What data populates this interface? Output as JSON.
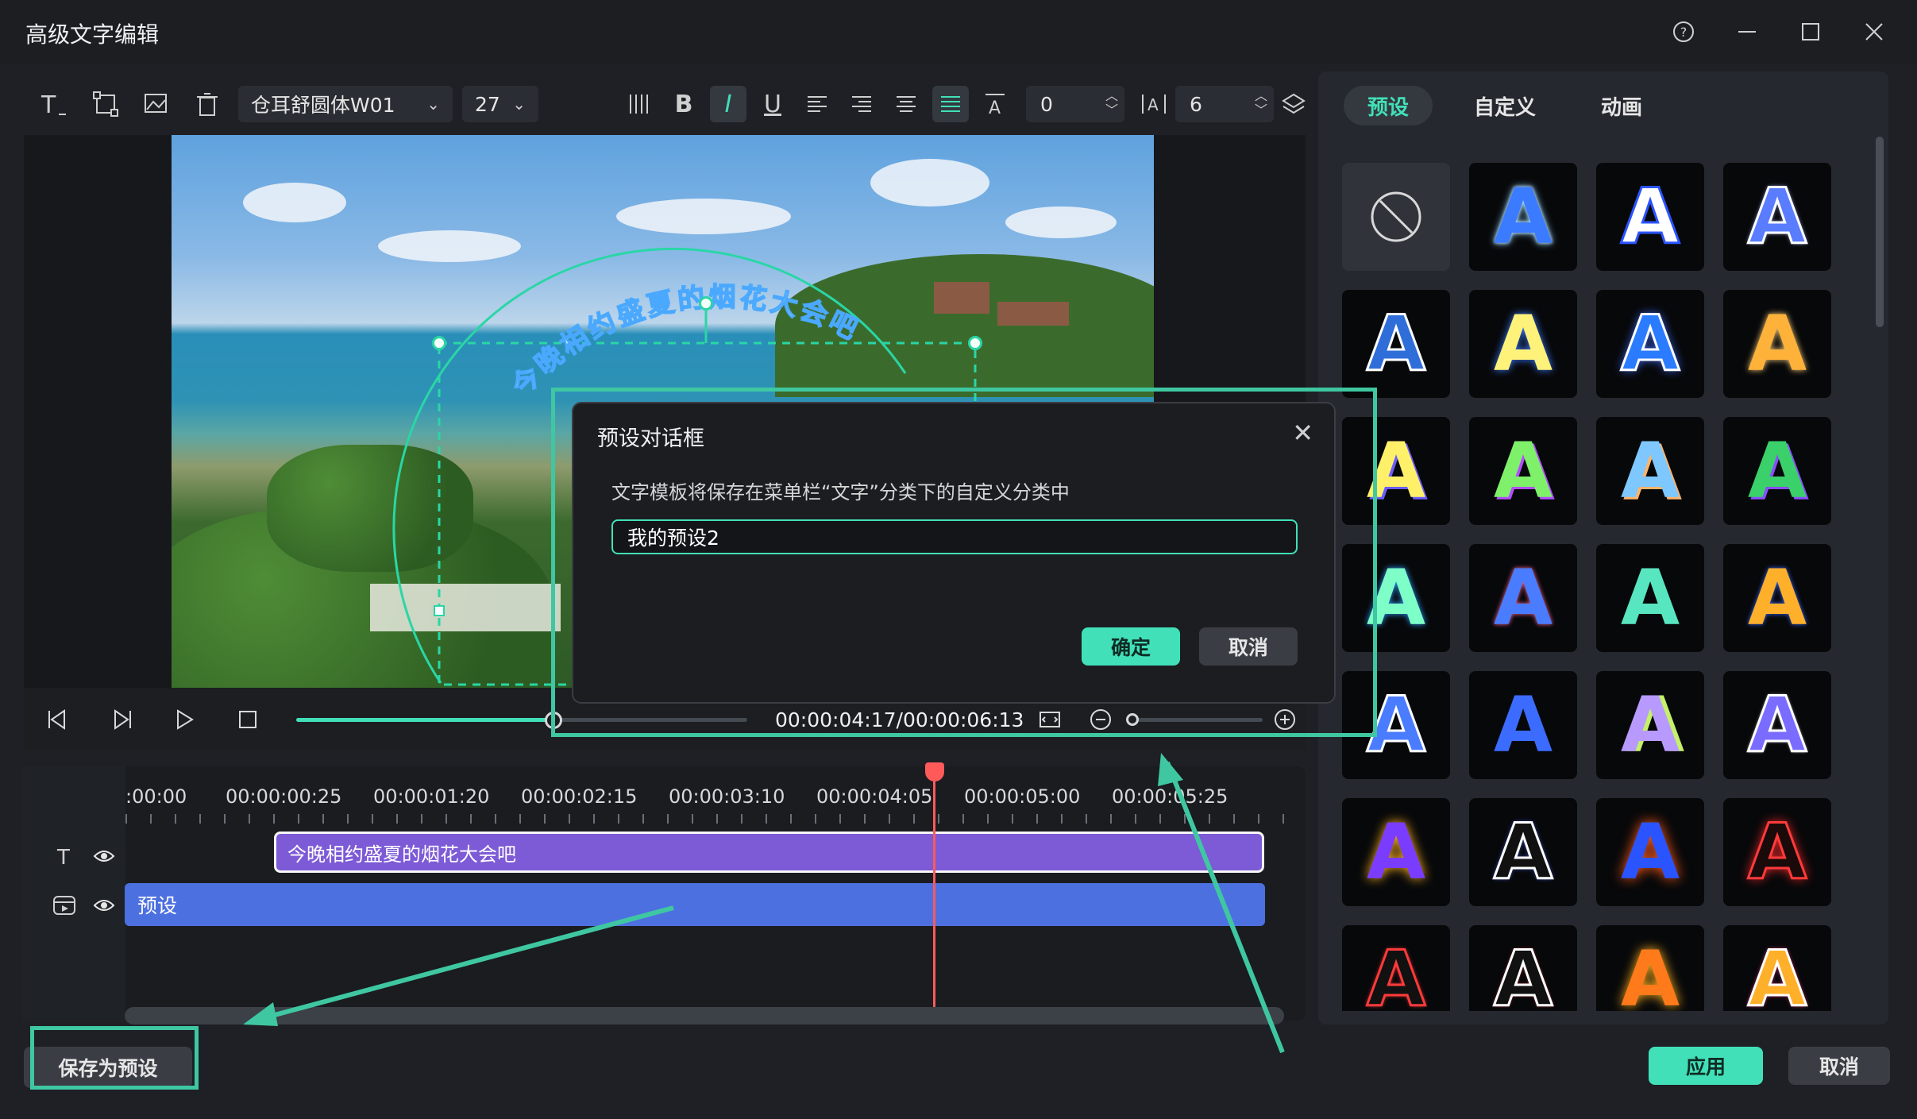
{
  "window": {
    "title": "高级文字编辑",
    "controls": [
      "help-icon",
      "minimize-icon",
      "maximize-icon",
      "close-icon"
    ]
  },
  "toolbar": {
    "font": "仓耳舒圆体W01",
    "font_size": "27",
    "char_spacing": "0",
    "line_spacing": "6",
    "icons": [
      "text-add-icon",
      "transform-icon",
      "image-add-icon",
      "trash-icon",
      "columns-icon",
      "bold-icon",
      "italic-icon",
      "underline-icon",
      "align-left-icon",
      "align-right-icon",
      "align-center-icon",
      "align-justify-icon",
      "char-spacing-icon",
      "line-spacing-icon",
      "layers-icon"
    ],
    "bold": "B",
    "italic": "I",
    "underline": "U"
  },
  "preview": {
    "arc_text": "今晚相约盛夏的烟花大会吧"
  },
  "playback": {
    "time": "00:00:04:17/00:00:06:13",
    "progress": 0.57
  },
  "timeline": {
    "ruler": [
      ":00:00",
      "00:00:00:25",
      "00:00:01:20",
      "00:00:02:15",
      "00:00:03:10",
      "00:00:04:05",
      "00:00:05:00",
      "00:00:05:25"
    ],
    "text_clip": "今晚相约盛夏的烟花大会吧",
    "preset_clip": "预设"
  },
  "bottom": {
    "save_preset": "保存为预设",
    "apply": "应用",
    "cancel": "取消"
  },
  "right_panel": {
    "tabs": [
      "预设",
      "自定义",
      "动画"
    ],
    "selected_tab": "预设"
  },
  "dialog": {
    "title": "预设对话框",
    "description": "文字模板将保存在菜单栏“文字”分类下的自定义分类中",
    "input_value": "我的预设2",
    "confirm": "确定",
    "cancel": "取消"
  },
  "colors": {
    "accent": "#41e0b8",
    "text_clip": "#7d5ad6",
    "preset_clip": "#4d70e0",
    "playhead": "#ff5a5a"
  }
}
